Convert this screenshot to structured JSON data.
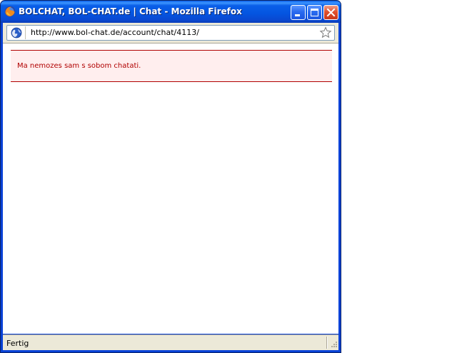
{
  "window": {
    "title": "BOLCHAT, BOL-CHAT.de | Chat - Mozilla Firefox",
    "app_icon": "firefox-icon",
    "controls": {
      "minimize_icon": "minimize-icon",
      "maximize_icon": "maximize-icon",
      "close_icon": "close-icon"
    }
  },
  "navbar": {
    "url": "http://www.bol-chat.de/account/chat/4113/",
    "site_icon": "globe-icon",
    "bookmark_icon": "star-icon"
  },
  "content": {
    "error_message": "Ma nemozes sam s sobom chatati."
  },
  "statusbar": {
    "text": "Fertig"
  },
  "colors": {
    "titlebar_blue": "#0454e0",
    "error_red": "#b00000",
    "error_bg": "#ffeeee",
    "chrome_beige": "#ece9d8"
  }
}
